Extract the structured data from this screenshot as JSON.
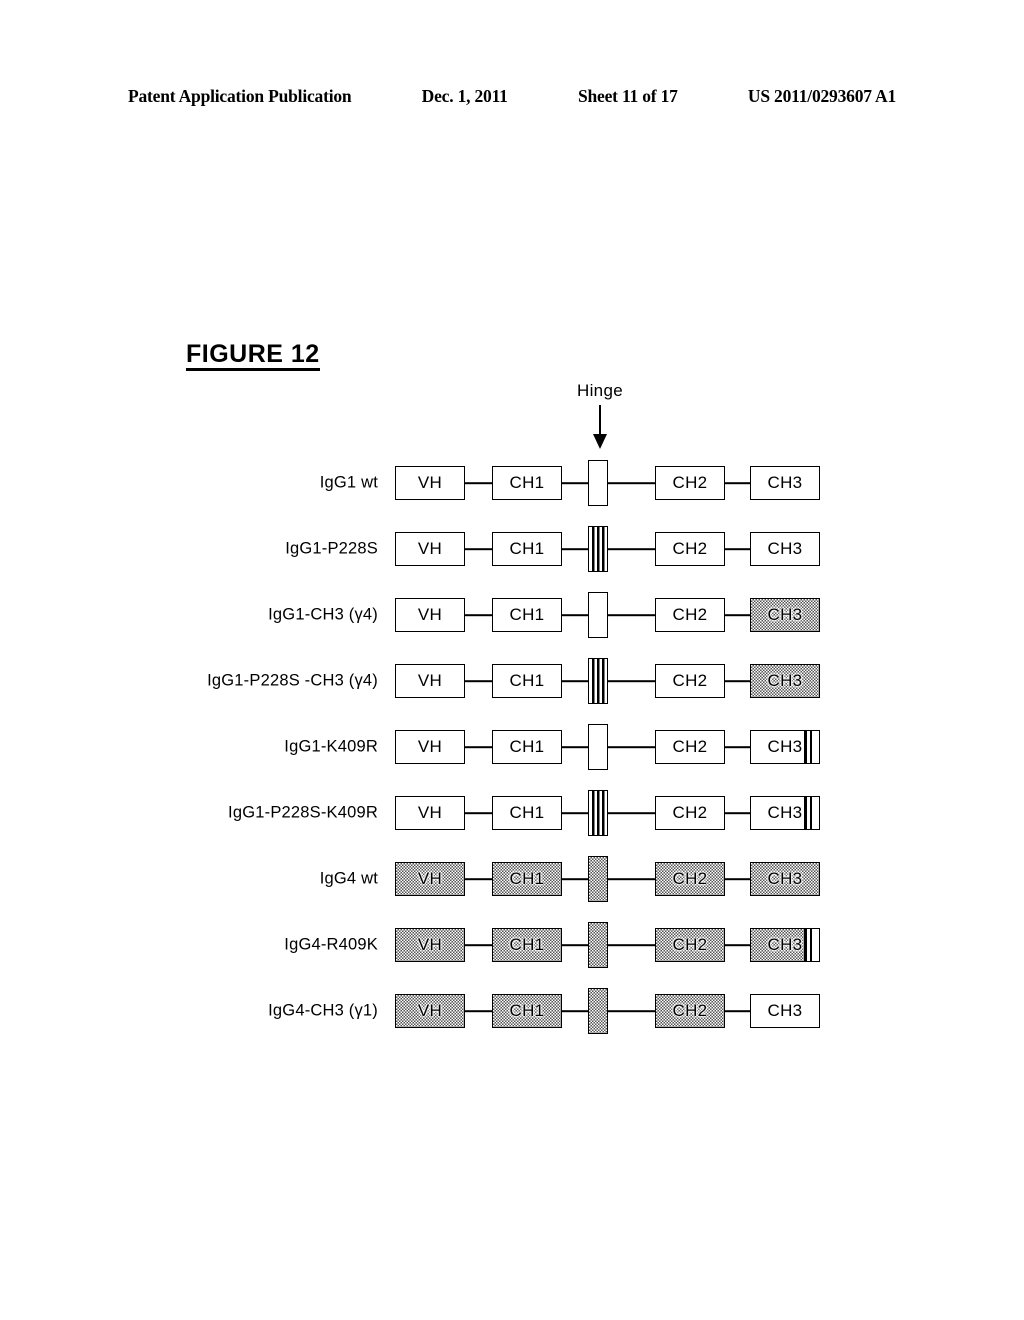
{
  "header": {
    "publication": "Patent Application Publication",
    "date": "Dec. 1, 2011",
    "sheet": "Sheet 11 of 17",
    "number": "US 2011/0293607 A1"
  },
  "figure": {
    "title": "FIGURE 12"
  },
  "annotation": {
    "hinge_label": "Hinge"
  },
  "domains": {
    "vh": "VH",
    "ch1": "CH1",
    "ch2": "CH2",
    "ch3": "CH3"
  },
  "rows": [
    {
      "label": "IgG1 wt",
      "vh": "VH",
      "ch1": "CH1",
      "ch2": "CH2",
      "ch3": "CH3",
      "vh_fill": "white",
      "ch1_fill": "white",
      "ch2_fill": "white",
      "ch3_fill": "white",
      "hinge_fill": "white",
      "hinge_striped": false,
      "ch3_striped": false
    },
    {
      "label": "IgG1-P228S",
      "vh": "VH",
      "ch1": "CH1",
      "ch2": "CH2",
      "ch3": "CH3",
      "vh_fill": "white",
      "ch1_fill": "white",
      "ch2_fill": "white",
      "ch3_fill": "white",
      "hinge_fill": "white",
      "hinge_striped": true,
      "ch3_striped": false
    },
    {
      "label": "IgG1-CH3 (γ4)",
      "vh": "VH",
      "ch1": "CH1",
      "ch2": "CH2",
      "ch3": "CH3",
      "vh_fill": "white",
      "ch1_fill": "white",
      "ch2_fill": "white",
      "ch3_fill": "gray",
      "hinge_fill": "white",
      "hinge_striped": false,
      "ch3_striped": false
    },
    {
      "label": "IgG1-P228S -CH3 (γ4)",
      "vh": "VH",
      "ch1": "CH1",
      "ch2": "CH2",
      "ch3": "CH3",
      "vh_fill": "white",
      "ch1_fill": "white",
      "ch2_fill": "white",
      "ch3_fill": "gray",
      "hinge_fill": "white",
      "hinge_striped": true,
      "ch3_striped": false
    },
    {
      "label": "IgG1-K409R",
      "vh": "VH",
      "ch1": "CH1",
      "ch2": "CH2",
      "ch3": "CH3",
      "vh_fill": "white",
      "ch1_fill": "white",
      "ch2_fill": "white",
      "ch3_fill": "white",
      "hinge_fill": "white",
      "hinge_striped": false,
      "ch3_striped": true
    },
    {
      "label": "IgG1-P228S-K409R",
      "vh": "VH",
      "ch1": "CH1",
      "ch2": "CH2",
      "ch3": "CH3",
      "vh_fill": "white",
      "ch1_fill": "white",
      "ch2_fill": "white",
      "ch3_fill": "white",
      "hinge_fill": "white",
      "hinge_striped": true,
      "ch3_striped": true
    },
    {
      "label": "IgG4 wt",
      "vh": "VH",
      "ch1": "CH1",
      "ch2": "CH2",
      "ch3": "CH3",
      "vh_fill": "gray",
      "ch1_fill": "gray",
      "ch2_fill": "gray",
      "ch3_fill": "gray",
      "hinge_fill": "gray",
      "hinge_striped": false,
      "ch3_striped": false
    },
    {
      "label": "IgG4-R409K",
      "vh": "VH",
      "ch1": "CH1",
      "ch2": "CH2",
      "ch3": "CH3",
      "vh_fill": "gray",
      "ch1_fill": "gray",
      "ch2_fill": "gray",
      "ch3_fill": "gray",
      "hinge_fill": "gray",
      "hinge_striped": false,
      "ch3_striped": true
    },
    {
      "label": "IgG4-CH3 (γ1)",
      "vh": "VH",
      "ch1": "CH1",
      "ch2": "CH2",
      "ch3": "CH3",
      "vh_fill": "gray",
      "ch1_fill": "gray",
      "ch2_fill": "gray",
      "ch3_fill": "white",
      "hinge_fill": "gray",
      "hinge_striped": false,
      "ch3_striped": false
    }
  ]
}
